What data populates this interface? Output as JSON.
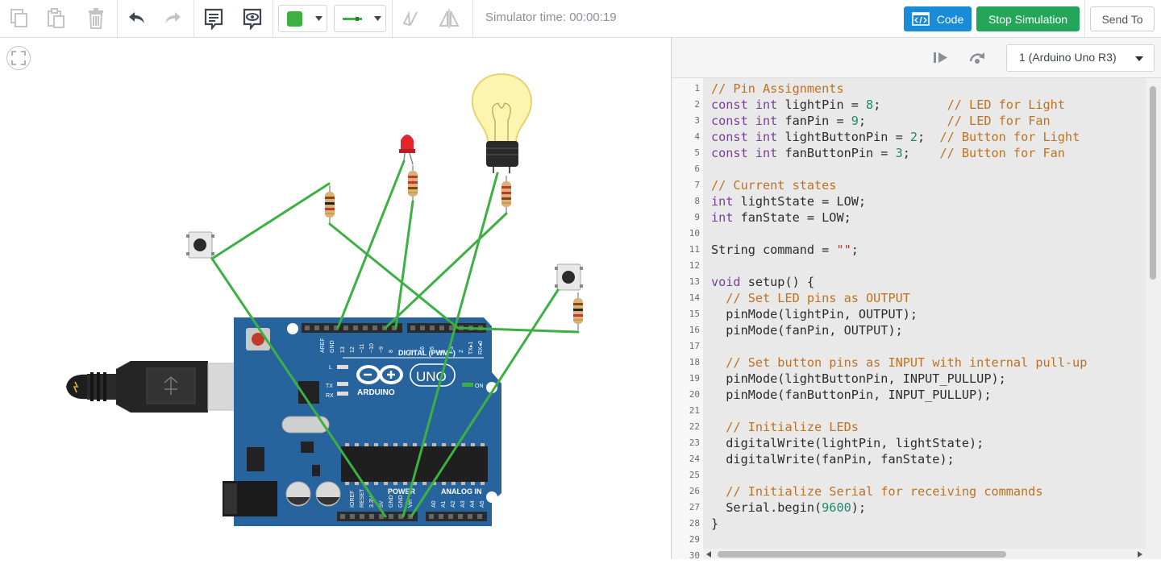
{
  "toolbar": {
    "icons": [
      "copy-icon",
      "paste-icon",
      "trash-icon",
      "undo-icon",
      "redo-icon",
      "notes-icon",
      "view-icon",
      "color-swatch",
      "wire-style",
      "mirror-icon",
      "flip-icon"
    ],
    "color_value": "#3cb043",
    "sim_time": "Simulator time: 00:00:19",
    "code_label": "Code",
    "stop_label": "Stop Simulation",
    "send_label": "Send To"
  },
  "code_panel": {
    "device": "1 (Arduino Uno R3)"
  },
  "board": {
    "brand": "ARDUINO",
    "model": "UNO",
    "digital_label": "DIGITAL (PWM~)",
    "power_label": "POWER",
    "analog_label": "ANALOG IN",
    "on_label": "ON",
    "l_label": "L",
    "tx_label": "TX",
    "rx_label": "RX"
  },
  "code": {
    "line_numbers": [
      "1",
      "2",
      "3",
      "4",
      "5",
      "6",
      "7",
      "8",
      "9",
      "10",
      "11",
      "12",
      "13",
      "14",
      "15",
      "16",
      "17",
      "18",
      "19",
      "20",
      "21",
      "22",
      "23",
      "24",
      "25",
      "26",
      "27",
      "28",
      "29",
      "30"
    ],
    "lines": [
      [
        {
          "t": "cm",
          "v": "// Pin Assignments"
        }
      ],
      [
        {
          "t": "kw",
          "v": "const int"
        },
        {
          "t": "",
          "v": " lightPin = "
        },
        {
          "t": "nm",
          "v": "8"
        },
        {
          "t": "",
          "v": ";         "
        },
        {
          "t": "cm",
          "v": "// LED for Light"
        }
      ],
      [
        {
          "t": "kw",
          "v": "const int"
        },
        {
          "t": "",
          "v": " fanPin = "
        },
        {
          "t": "nm",
          "v": "9"
        },
        {
          "t": "",
          "v": ";           "
        },
        {
          "t": "cm",
          "v": "// LED for Fan"
        }
      ],
      [
        {
          "t": "kw",
          "v": "const int"
        },
        {
          "t": "",
          "v": " lightButtonPin = "
        },
        {
          "t": "nm",
          "v": "2"
        },
        {
          "t": "",
          "v": ";  "
        },
        {
          "t": "cm",
          "v": "// Button for Light"
        }
      ],
      [
        {
          "t": "kw",
          "v": "const int"
        },
        {
          "t": "",
          "v": " fanButtonPin = "
        },
        {
          "t": "nm",
          "v": "3"
        },
        {
          "t": "",
          "v": ";    "
        },
        {
          "t": "cm",
          "v": "// Button for Fan"
        }
      ],
      [],
      [
        {
          "t": "cm",
          "v": "// Current states"
        }
      ],
      [
        {
          "t": "kw",
          "v": "int"
        },
        {
          "t": "",
          "v": " lightState = LOW;"
        }
      ],
      [
        {
          "t": "kw",
          "v": "int"
        },
        {
          "t": "",
          "v": " fanState = LOW;"
        }
      ],
      [],
      [
        {
          "t": "",
          "v": "String command = "
        },
        {
          "t": "st",
          "v": "\"\""
        },
        {
          "t": "",
          "v": ";"
        }
      ],
      [],
      [
        {
          "t": "kw",
          "v": "void"
        },
        {
          "t": "",
          "v": " setup() {"
        }
      ],
      [
        {
          "t": "",
          "v": "  "
        },
        {
          "t": "cm",
          "v": "// Set LED pins as OUTPUT"
        }
      ],
      [
        {
          "t": "",
          "v": "  pinMode(lightPin, OUTPUT);"
        }
      ],
      [
        {
          "t": "",
          "v": "  pinMode(fanPin, OUTPUT);"
        }
      ],
      [],
      [
        {
          "t": "",
          "v": "  "
        },
        {
          "t": "cm",
          "v": "// Set button pins as INPUT with internal pull-up"
        }
      ],
      [
        {
          "t": "",
          "v": "  pinMode(lightButtonPin, INPUT_PULLUP);"
        }
      ],
      [
        {
          "t": "",
          "v": "  pinMode(fanButtonPin, INPUT_PULLUP);"
        }
      ],
      [],
      [
        {
          "t": "",
          "v": "  "
        },
        {
          "t": "cm",
          "v": "// Initialize LEDs"
        }
      ],
      [
        {
          "t": "",
          "v": "  digitalWrite(lightPin, lightState);"
        }
      ],
      [
        {
          "t": "",
          "v": "  digitalWrite(fanPin, fanState);"
        }
      ],
      [],
      [
        {
          "t": "",
          "v": "  "
        },
        {
          "t": "cm",
          "v": "// Initialize Serial for receiving commands"
        }
      ],
      [
        {
          "t": "",
          "v": "  Serial.begin("
        },
        {
          "t": "nm",
          "v": "9600"
        },
        {
          "t": "",
          "v": ");"
        }
      ],
      [
        {
          "t": "",
          "v": "}"
        }
      ],
      [],
      []
    ]
  }
}
